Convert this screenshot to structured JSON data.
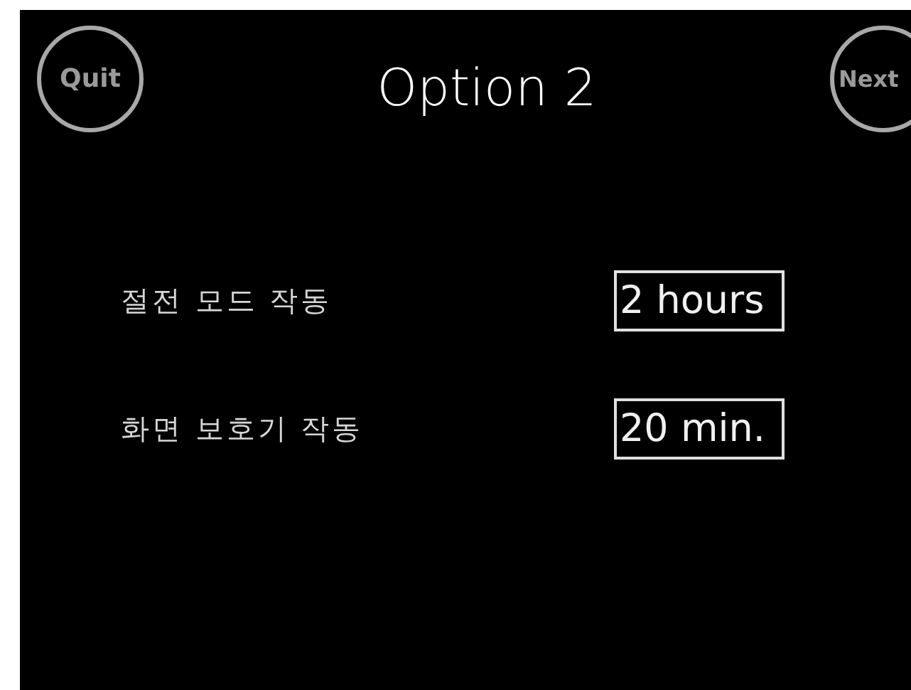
{
  "header": {
    "quit_button": "Quit",
    "title": "Option 2",
    "next_button": "Next"
  },
  "settings": [
    {
      "label": "절전 모드 작동",
      "value": "2 hours"
    },
    {
      "label": "화면 보호기 작동",
      "value": "20 min."
    }
  ]
}
